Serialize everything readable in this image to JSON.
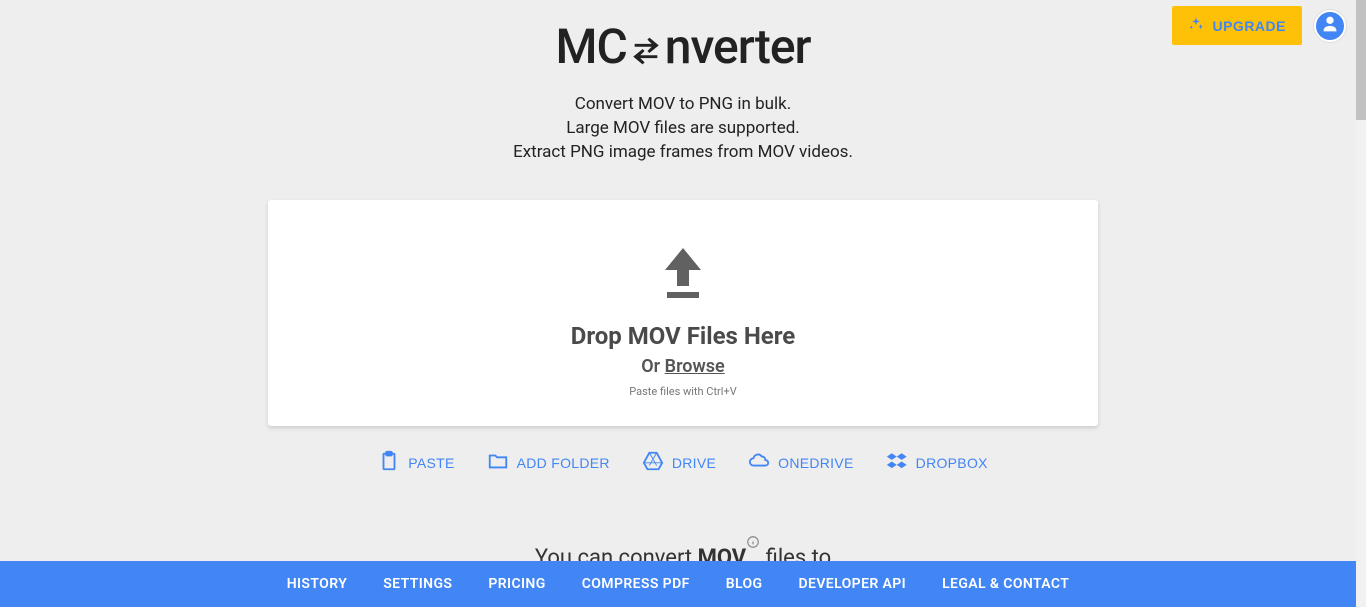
{
  "header": {
    "upgrade_label": "UPGRADE",
    "logo_left": "MC",
    "logo_right": "nverter"
  },
  "subtitle": {
    "line1": "Convert MOV to PNG in bulk.",
    "line2": "Large MOV files are supported.",
    "line3": "Extract PNG image frames from MOV videos."
  },
  "dropzone": {
    "title": "Drop MOV Files Here",
    "or": "Or ",
    "browse": "Browse",
    "paste_hint": "Paste files with Ctrl+V"
  },
  "sources": {
    "paste": "PASTE",
    "add_folder": "ADD FOLDER",
    "drive": "DRIVE",
    "onedrive": "ONEDRIVE",
    "dropbox": "DROPBOX"
  },
  "convert": {
    "prefix": "You can convert ",
    "format": "MOV",
    "suffix": " files to"
  },
  "footer": {
    "history": "HISTORY",
    "settings": "SETTINGS",
    "pricing": "PRICING",
    "compress": "COMPRESS PDF",
    "blog": "BLOG",
    "api": "DEVELOPER API",
    "legal": "LEGAL & CONTACT"
  }
}
